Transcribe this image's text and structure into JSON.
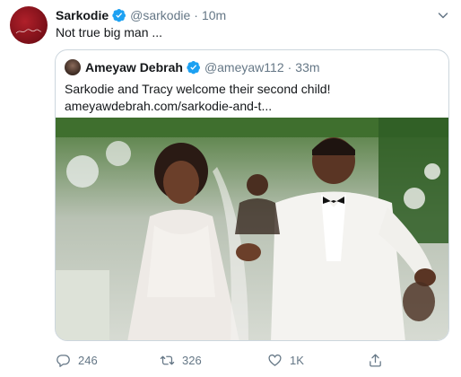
{
  "tweet": {
    "author_name": "Sarkodie",
    "author_handle": "@sarkodie",
    "separator": "·",
    "time": "10m",
    "text": "Not true big man ..."
  },
  "quoted_tweet": {
    "author_name": "Ameyaw Debrah",
    "author_handle": "@ameyaw112",
    "separator": "·",
    "time": "33m",
    "text_line1": "Sarkodie and Tracy welcome their second child!",
    "link": "ameyawdebrah.com/sarkodie-and-t..."
  },
  "actions": {
    "replies": "246",
    "retweets": "326",
    "likes": "1K"
  },
  "icons": {
    "verified": "verified-badge-icon",
    "caret": "chevron-down-icon",
    "reply": "reply-icon",
    "retweet": "retweet-icon",
    "like": "heart-icon",
    "share": "share-icon"
  },
  "colors": {
    "verified_blue": "#1da1f2",
    "secondary_text": "#657786",
    "border": "#ccd6dd"
  }
}
